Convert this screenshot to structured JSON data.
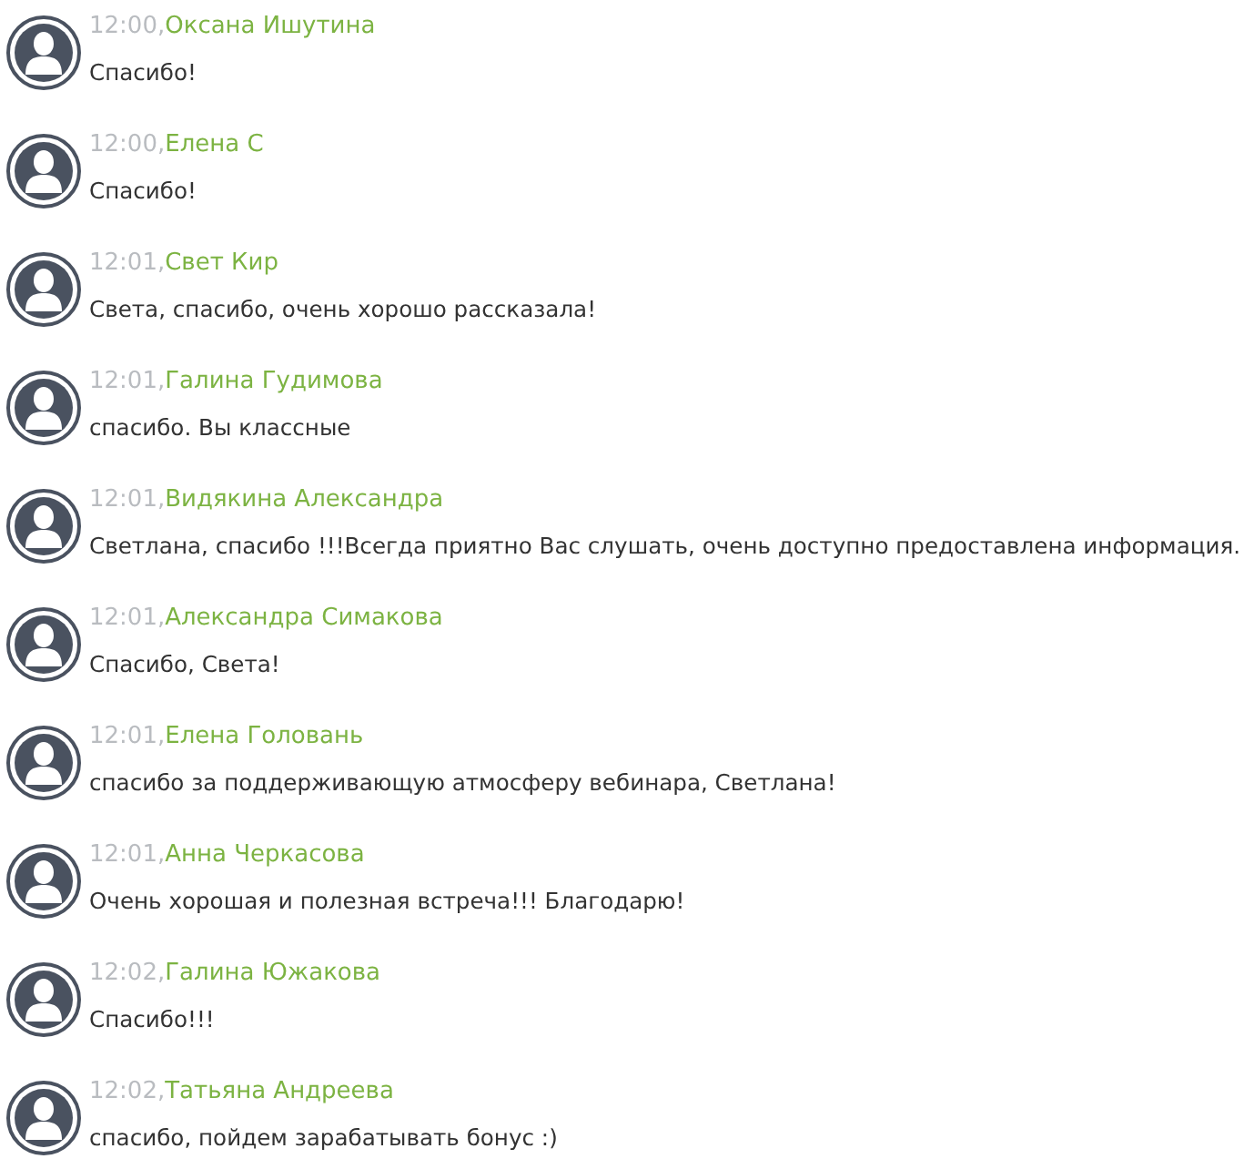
{
  "messages": [
    {
      "time": "12:00,",
      "author": "Оксана Ишутина",
      "text": "Спасибо!"
    },
    {
      "time": "12:00,",
      "author": "Елена С",
      "text": "Спасибо!"
    },
    {
      "time": "12:01,",
      "author": "Свет Кир",
      "text": "Света, спасибо, очень хорошо рассказала!"
    },
    {
      "time": "12:01,",
      "author": "Галина Гудимова",
      "text": "спасибо. Вы классные"
    },
    {
      "time": "12:01,",
      "author": "Видякина Александра",
      "text": "Светлана, спасибо !!!Всегда приятно Вас слушать, очень доступно предоставлена информация."
    },
    {
      "time": "12:01,",
      "author": "Александра Симакова",
      "text": "Спасибо, Света!"
    },
    {
      "time": "12:01,",
      "author": "Елена Головань",
      "text": "спасибо за поддерживающую атмосферу вебинара, Светлана!"
    },
    {
      "time": "12:01,",
      "author": "Анна Черкасова",
      "text": "Очень хорошая и полезная встреча!!! Благодарю!"
    },
    {
      "time": "12:02,",
      "author": "Галина Южакова",
      "text": "Спасибо!!!"
    },
    {
      "time": "12:02,",
      "author": "Татьяна Андреева",
      "text": "спасибо, пойдем зарабатывать бонус :)"
    }
  ]
}
